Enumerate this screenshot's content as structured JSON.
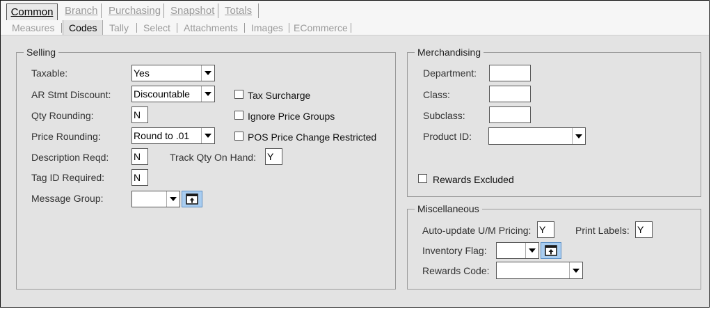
{
  "tabs_top": [
    {
      "label": "Common",
      "active": true
    },
    {
      "label": "Branch",
      "active": false
    },
    {
      "label": "Purchasing",
      "active": false
    },
    {
      "label": "Snapshot",
      "active": false
    },
    {
      "label": "Totals",
      "active": false
    }
  ],
  "tabs_sub": [
    {
      "label": "Measures",
      "active": false
    },
    {
      "label": "Codes",
      "active": true
    },
    {
      "label": "Tally",
      "active": false
    },
    {
      "label": "Select",
      "active": false
    },
    {
      "label": "Attachments",
      "active": false
    },
    {
      "label": "Images",
      "active": false
    },
    {
      "label": "ECommerce",
      "active": false
    }
  ],
  "selling": {
    "title": "Selling",
    "taxable": {
      "label": "Taxable:",
      "value": "Yes"
    },
    "ar_stmt_discount": {
      "label": "AR Stmt Discount:",
      "value": "Discountable"
    },
    "qty_rounding": {
      "label": "Qty Rounding:",
      "value": "N"
    },
    "price_rounding": {
      "label": "Price Rounding:",
      "value": "Round to .01"
    },
    "description_reqd": {
      "label": "Description Reqd:",
      "value": "N"
    },
    "track_qty_on_hand": {
      "label": "Track Qty On Hand:",
      "value": "Y"
    },
    "tag_id_required": {
      "label": "Tag ID Required:",
      "value": "N"
    },
    "message_group": {
      "label": "Message Group:",
      "value": ""
    },
    "tax_surcharge": {
      "label": "Tax Surcharge",
      "checked": false
    },
    "ignore_price_groups": {
      "label": "Ignore Price Groups",
      "checked": false
    },
    "pos_price_change_restricted": {
      "label": "POS Price Change Restricted",
      "checked": false
    }
  },
  "merchandising": {
    "title": "Merchandising",
    "department": {
      "label": "Department:",
      "value": ""
    },
    "class": {
      "label": "Class:",
      "value": ""
    },
    "subclass": {
      "label": "Subclass:",
      "value": ""
    },
    "product_id": {
      "label": "Product ID:",
      "value": ""
    },
    "rewards_excluded": {
      "label": "Rewards Excluded",
      "checked": false
    }
  },
  "miscellaneous": {
    "title": "Miscellaneous",
    "auto_update_um_pricing": {
      "label": "Auto-update U/M Pricing:",
      "value": "Y"
    },
    "print_labels": {
      "label": "Print Labels:",
      "value": "Y"
    },
    "inventory_flag": {
      "label": "Inventory Flag:",
      "value": ""
    },
    "rewards_code": {
      "label": "Rewards Code:",
      "value": ""
    }
  },
  "colors": {
    "panel_bg": "#e3e3e3",
    "tab_bg": "#f6f6f6",
    "lookup_button": "#a9cdf0"
  },
  "icons": {
    "dropdown": "chevron-down-icon",
    "lookup": "lookup-icon"
  }
}
